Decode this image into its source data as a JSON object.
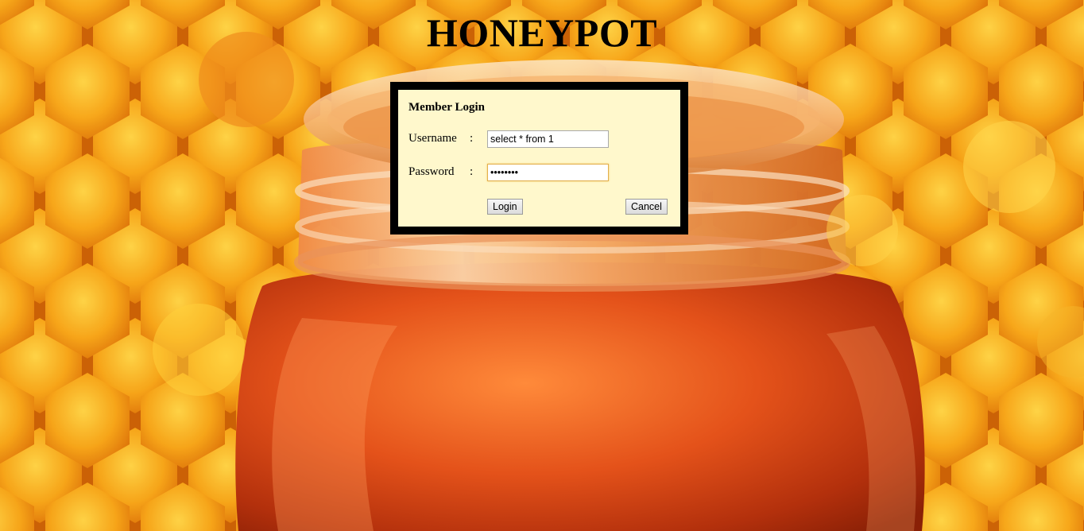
{
  "page": {
    "title": "HONEYPOT"
  },
  "login": {
    "heading": "Member Login",
    "username_label": "Username",
    "password_label": "Password",
    "colon": ":",
    "username_value": "select * from 1",
    "password_value": "********",
    "login_button": "Login",
    "cancel_button": "Cancel"
  },
  "theme": {
    "box_background": "#fff8cc",
    "box_border": "#000000",
    "honey_orange": "#e88a10",
    "jar_red": "#c2410c"
  },
  "icons": {
    "background": "honeycomb-honey-jar-image"
  }
}
